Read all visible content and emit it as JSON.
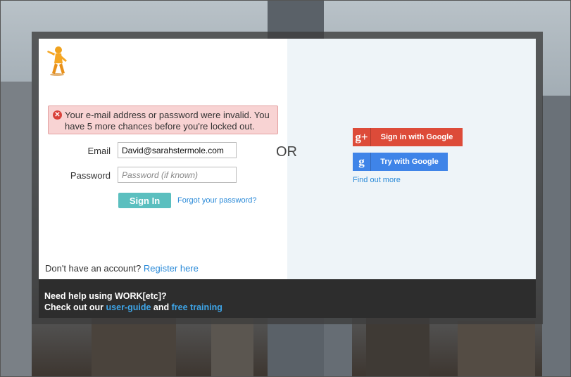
{
  "error": {
    "message": "Your e-mail address or password were invalid. You have 5 more chances before you're locked out."
  },
  "form": {
    "email_label": "Email",
    "email_value": "David@sarahstermole.com",
    "password_label": "Password",
    "password_placeholder": "Password (if known)",
    "signin_label": "Sign In",
    "forgot_label": "Forgot your password?"
  },
  "divider": {
    "or_label": "OR"
  },
  "register": {
    "prompt": "Don't have an account?",
    "link": "Register here"
  },
  "google": {
    "plus_icon_text": "g+",
    "signin_label": "Sign in with Google",
    "g_icon_text": "g",
    "try_label": "Try with Google",
    "find_out_more": "Find out more"
  },
  "footer": {
    "help_text": "Need help using WORK[etc]?",
    "checkout_text": "Check out our",
    "user_guide": "user-guide",
    "and_text": "and",
    "free_training": "free training"
  },
  "colors": {
    "signin_button": "#5bbfbf",
    "google_plus": "#dd4b39",
    "google_try": "#3f84e8",
    "link": "#2a8ad8",
    "error_bg": "#f8d3d3"
  }
}
